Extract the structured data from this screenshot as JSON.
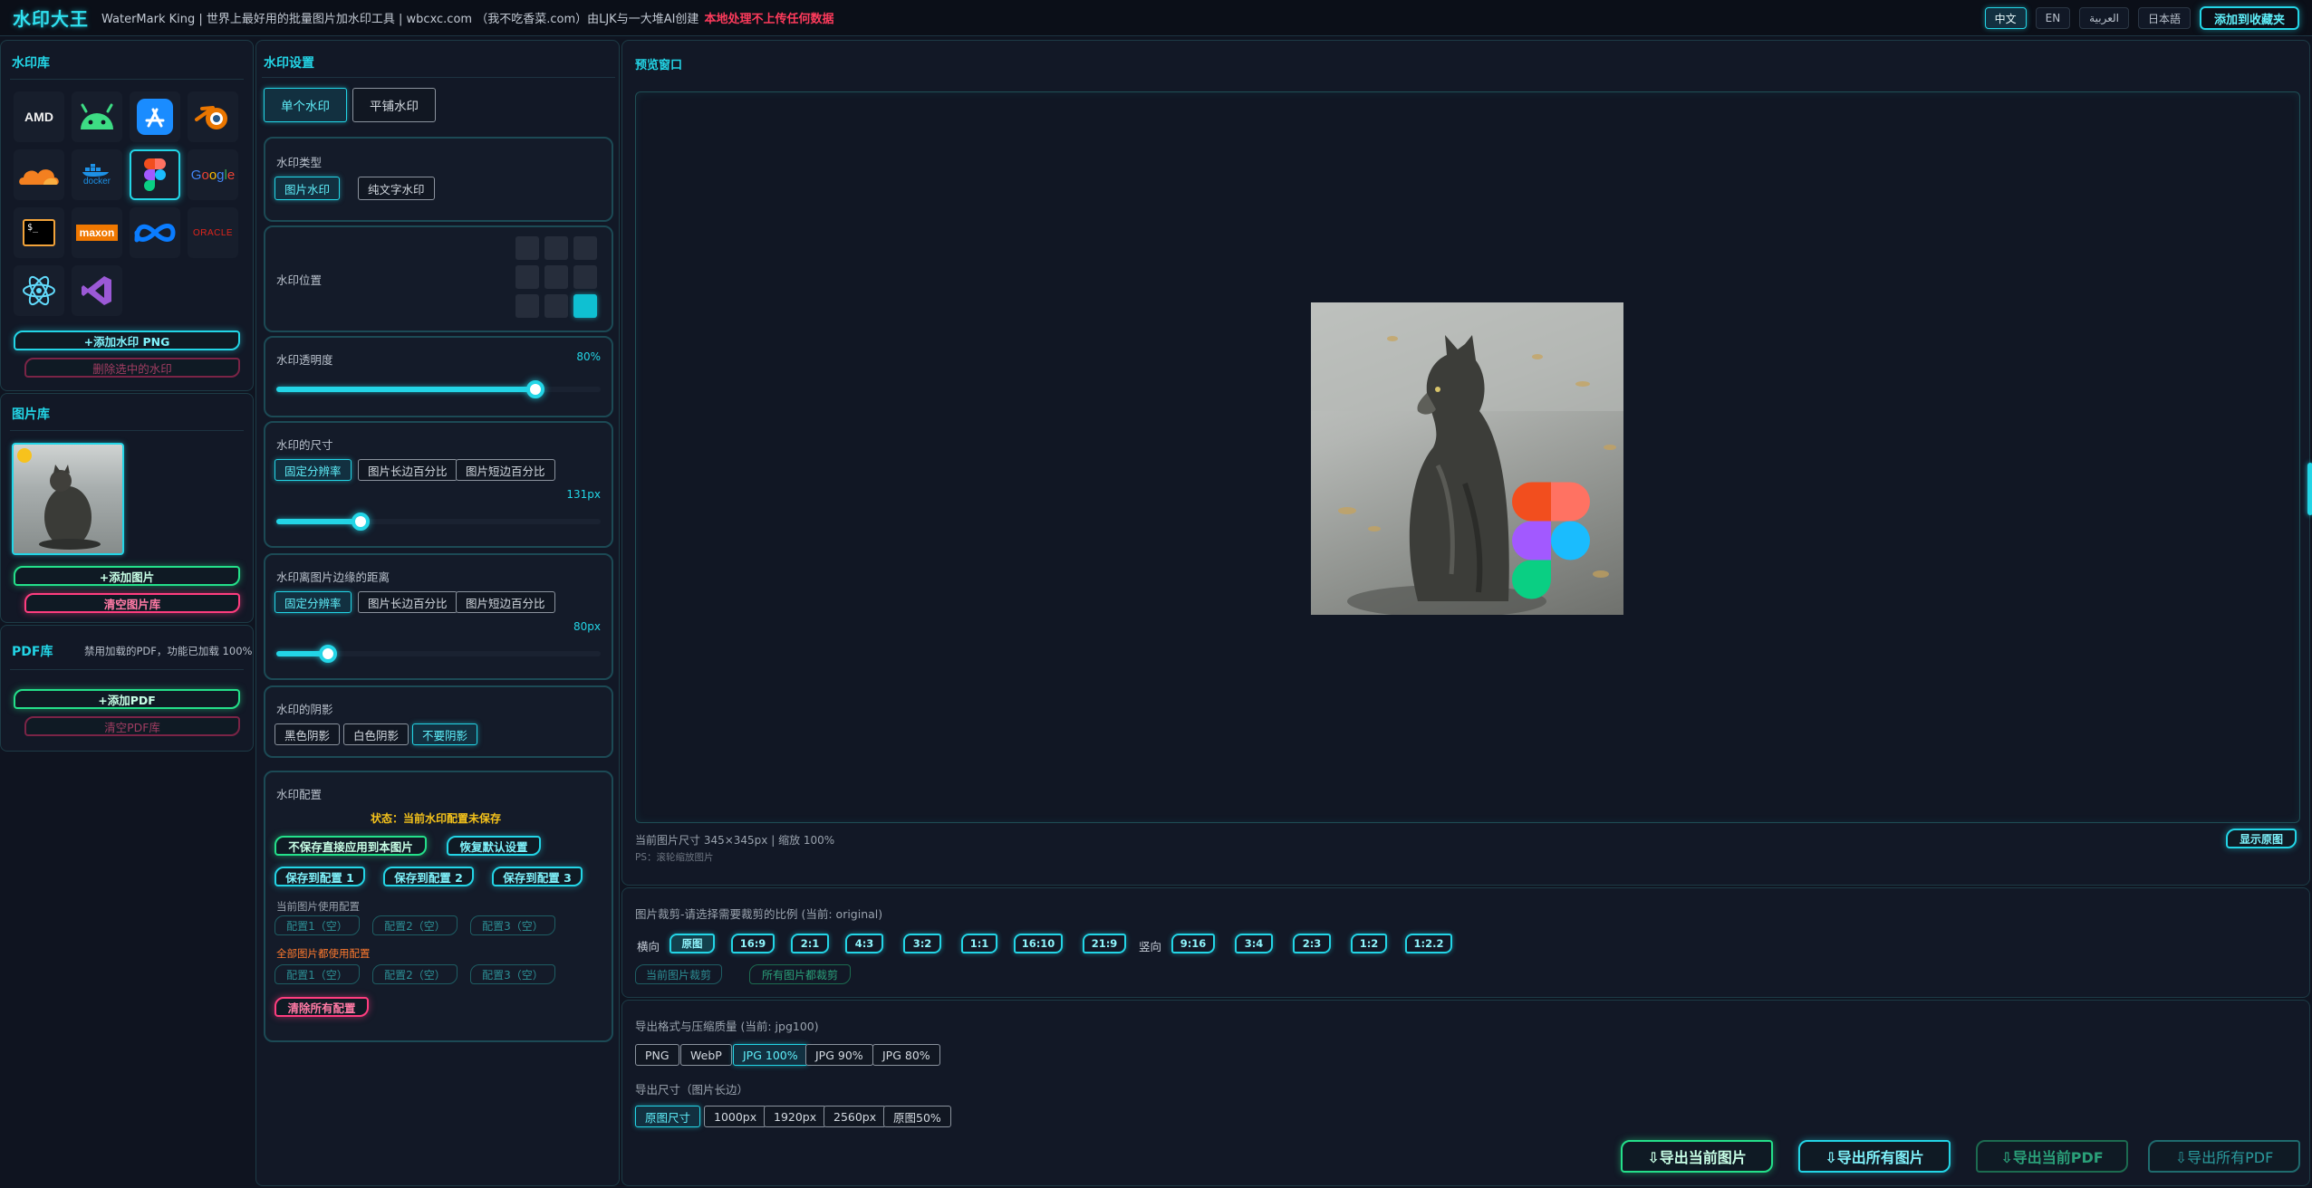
{
  "topbar": {
    "brand": "水印大王",
    "tagline": "WaterMark King | 世界上最好用的批量图片加水印工具 | wbcxc.com （我不吃香菜.com）由LJK与一大堆AI创建",
    "warning": "本地处理不上传任何数据",
    "languages": [
      "中文",
      "EN",
      "العربية",
      "日本語"
    ],
    "active_language": "中文",
    "favorite": "添加到收藏夹"
  },
  "watermark_lib": {
    "title": "水印库",
    "logos": [
      {
        "name": "AMD",
        "text": "AMD"
      },
      {
        "name": "Android",
        "text": ""
      },
      {
        "name": "App Store",
        "text": ""
      },
      {
        "name": "Blender",
        "text": ""
      },
      {
        "name": "Cloudflare",
        "text": ""
      },
      {
        "name": "Docker",
        "text": "docker"
      },
      {
        "name": "Figma",
        "text": ""
      },
      {
        "name": "Google",
        "text": "Google"
      },
      {
        "name": "Terminal",
        "text": "$_"
      },
      {
        "name": "Maxon",
        "text": "maxon"
      },
      {
        "name": "Meta",
        "text": "∞"
      },
      {
        "name": "Oracle",
        "text": "ORACLE"
      },
      {
        "name": "React",
        "text": ""
      },
      {
        "name": "Visual Studio",
        "text": ""
      }
    ],
    "add_button": "+添加水印 PNG",
    "delete_button": "删除选中的水印"
  },
  "image_lib": {
    "title": "图片库",
    "add_button": "+添加图片",
    "clear_button": "清空图片库"
  },
  "pdf_lib": {
    "title": "PDF库",
    "note": "禁用加载的PDF，功能已加载 100%",
    "add_button": "+添加PDF",
    "clear_button": "清空PDF库"
  },
  "settings": {
    "title": "水印设置",
    "mode_tabs": [
      "单个水印",
      "平铺水印"
    ],
    "type": {
      "label": "水印类型",
      "options": [
        "图片水印",
        "纯文字水印"
      ]
    },
    "position": {
      "label": "水印位置"
    },
    "opacity": {
      "label": "水印透明度",
      "value": "80%",
      "fraction": 0.8
    },
    "size": {
      "label": "水印的尺寸",
      "options": [
        "固定分辨率",
        "图片长边百分比",
        "图片短边百分比"
      ],
      "value": "131px",
      "fraction": 0.26
    },
    "margin": {
      "label": "水印离图片边缘的距离",
      "options": [
        "固定分辨率",
        "图片长边百分比",
        "图片短边百分比"
      ],
      "value": "80px",
      "fraction": 0.16
    },
    "shadow": {
      "label": "水印的阴影",
      "options": [
        "黑色阴影",
        "白色阴影",
        "不要阴影"
      ]
    },
    "config": {
      "label": "水印配置",
      "status": "状态：当前水印配置未保存",
      "apply_button": "不保存直接应用到本图片",
      "reset_button": "恢复默认设置",
      "save_buttons": [
        "保存到配置 1",
        "保存到配置 2",
        "保存到配置 3"
      ],
      "current_label": "当前图片使用配置",
      "current_slots": [
        "配置1（空）",
        "配置2（空）",
        "配置3（空）"
      ],
      "all_label": "全部图片都使用配置",
      "all_slots": [
        "配置1（空）",
        "配置2（空）",
        "配置3（空）"
      ],
      "clear_button": "清除所有配置"
    }
  },
  "preview": {
    "title": "预览窗口",
    "info": "当前图片尺寸 345×345px | 缩放 100%",
    "hint": "PS：滚轮缩放图片",
    "show_original": "显示原图"
  },
  "crop": {
    "label": "图片裁剪-请选择需要裁剪的比例 (当前: original)",
    "landscape_label": "横向",
    "landscape": [
      "原图",
      "16:9",
      "2:1",
      "4:3",
      "3:2",
      "1:1",
      "16:10",
      "21:9"
    ],
    "portrait_label": "竖向",
    "portrait": [
      "9:16",
      "3:4",
      "2:3",
      "1:2",
      "1:2.2"
    ],
    "crop_current": "当前图片裁剪",
    "crop_all": "所有图片都裁剪"
  },
  "export": {
    "format_label": "导出格式与压缩质量 (当前: jpg100)",
    "formats": [
      "PNG",
      "WebP",
      "JPG 100%",
      "JPG 90%",
      "JPG 80%"
    ],
    "size_label": "导出尺寸（图片长边）",
    "sizes": [
      "原图尺寸",
      "1000px",
      "1920px",
      "2560px",
      "原图50%"
    ],
    "buttons": [
      "⇩导出当前图片",
      "⇩导出所有图片",
      "⇩导出当前PDF",
      "⇩导出所有PDF"
    ]
  },
  "colors": {
    "accent": "#23d5e6",
    "green": "#24e08a",
    "pink": "#ff3d7f",
    "warning": "#ff3b5c",
    "status": "#f4c21b"
  }
}
